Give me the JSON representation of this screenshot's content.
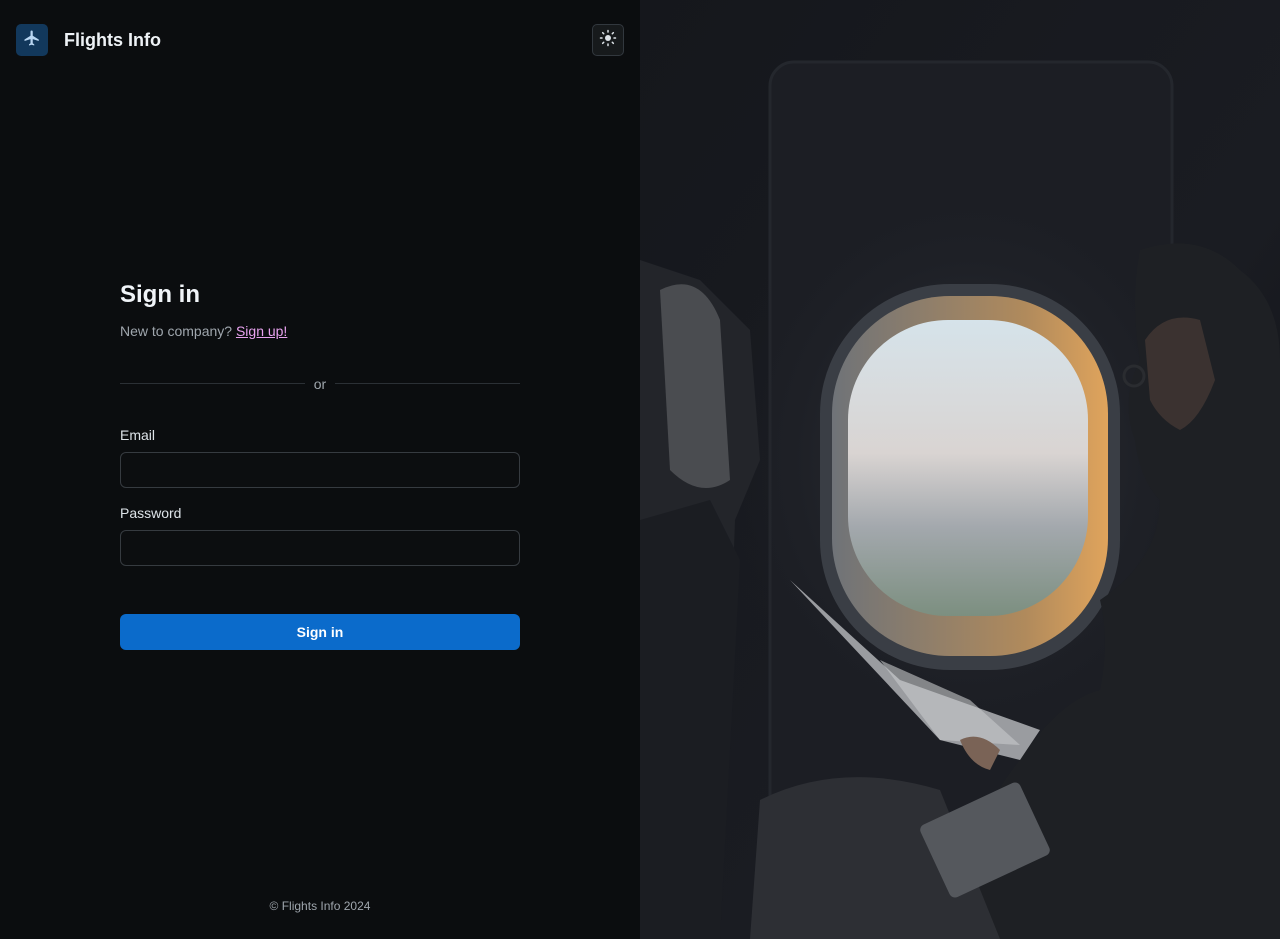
{
  "header": {
    "brand": "Flights Info",
    "logo_icon": "plane-icon",
    "theme_toggle_icon": "sun-icon"
  },
  "signin": {
    "title": "Sign in",
    "prompt": "New to company?",
    "signup_link": "Sign up!",
    "divider_text": "or",
    "email_label": "Email",
    "email_value": "",
    "password_label": "Password",
    "password_value": "",
    "submit_label": "Sign in"
  },
  "footer": {
    "copyright": "© Flights Info 2024"
  },
  "colors": {
    "accent": "#0b6bcb",
    "link": "#e8a2ef",
    "background": "#0b0d0f",
    "logo_bg": "#12385c"
  }
}
